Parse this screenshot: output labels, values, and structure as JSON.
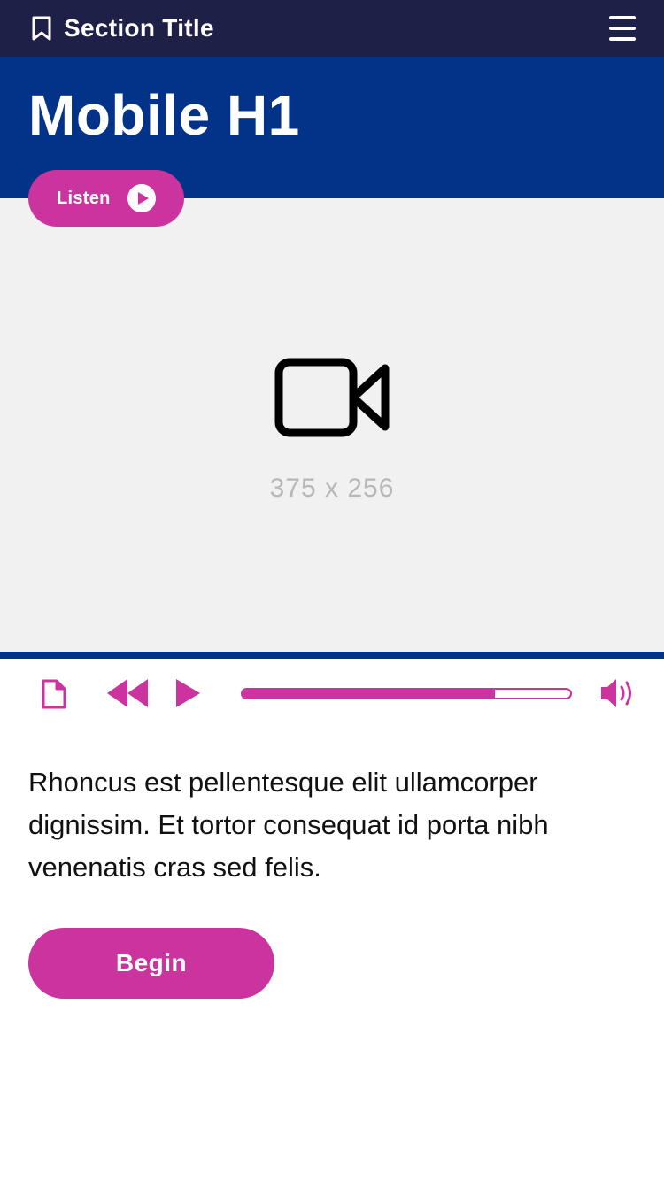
{
  "header": {
    "section_title": "Section Title",
    "bookmark_icon": "bookmark-icon",
    "menu_icon": "hamburger-menu-icon"
  },
  "hero": {
    "title": "Mobile H1"
  },
  "listen": {
    "label": "Listen",
    "icon": "play-circle-icon"
  },
  "media": {
    "icon": "video-camera-icon",
    "dimensions": "375 x 256"
  },
  "player": {
    "progress_fraction": 0.77,
    "icons": [
      "document-icon",
      "rewind-icon",
      "play-icon",
      "volume-icon"
    ]
  },
  "content": {
    "paragraph": "Rhoncus est pellentesque elit ullamcorper dignissim. Et tortor consequat id porta nibh venenatis cras sed felis.",
    "begin_label": "Begin"
  },
  "colors": {
    "topbar": "#1f2048",
    "brand_blue": "#023389",
    "accent_magenta": "#cb349e",
    "media_bg": "#f1f1f1"
  }
}
